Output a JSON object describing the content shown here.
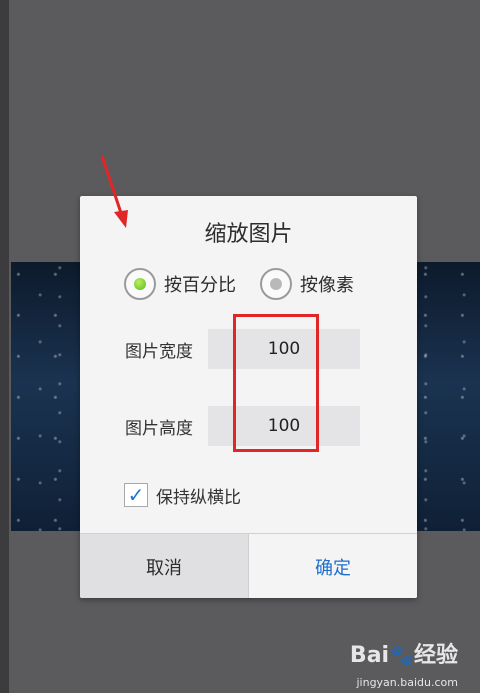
{
  "dialog": {
    "title": "缩放图片",
    "radio_options": [
      {
        "label": "按百分比",
        "selected": true
      },
      {
        "label": "按像素",
        "selected": false
      }
    ],
    "fields": [
      {
        "label": "图片宽度",
        "value": "100"
      },
      {
        "label": "图片高度",
        "value": "100"
      }
    ],
    "checkbox": {
      "label": "保持纵横比",
      "checked": true
    },
    "buttons": {
      "cancel": "取消",
      "ok": "确定"
    }
  },
  "colors": {
    "accent_blue": "#1e6fcb",
    "radio_selected": "#5cb818",
    "annotation_red": "#e02626"
  },
  "watermark": {
    "brand_left": "Bai",
    "brand_right": "经验",
    "url": "jingyan.baidu.com"
  }
}
